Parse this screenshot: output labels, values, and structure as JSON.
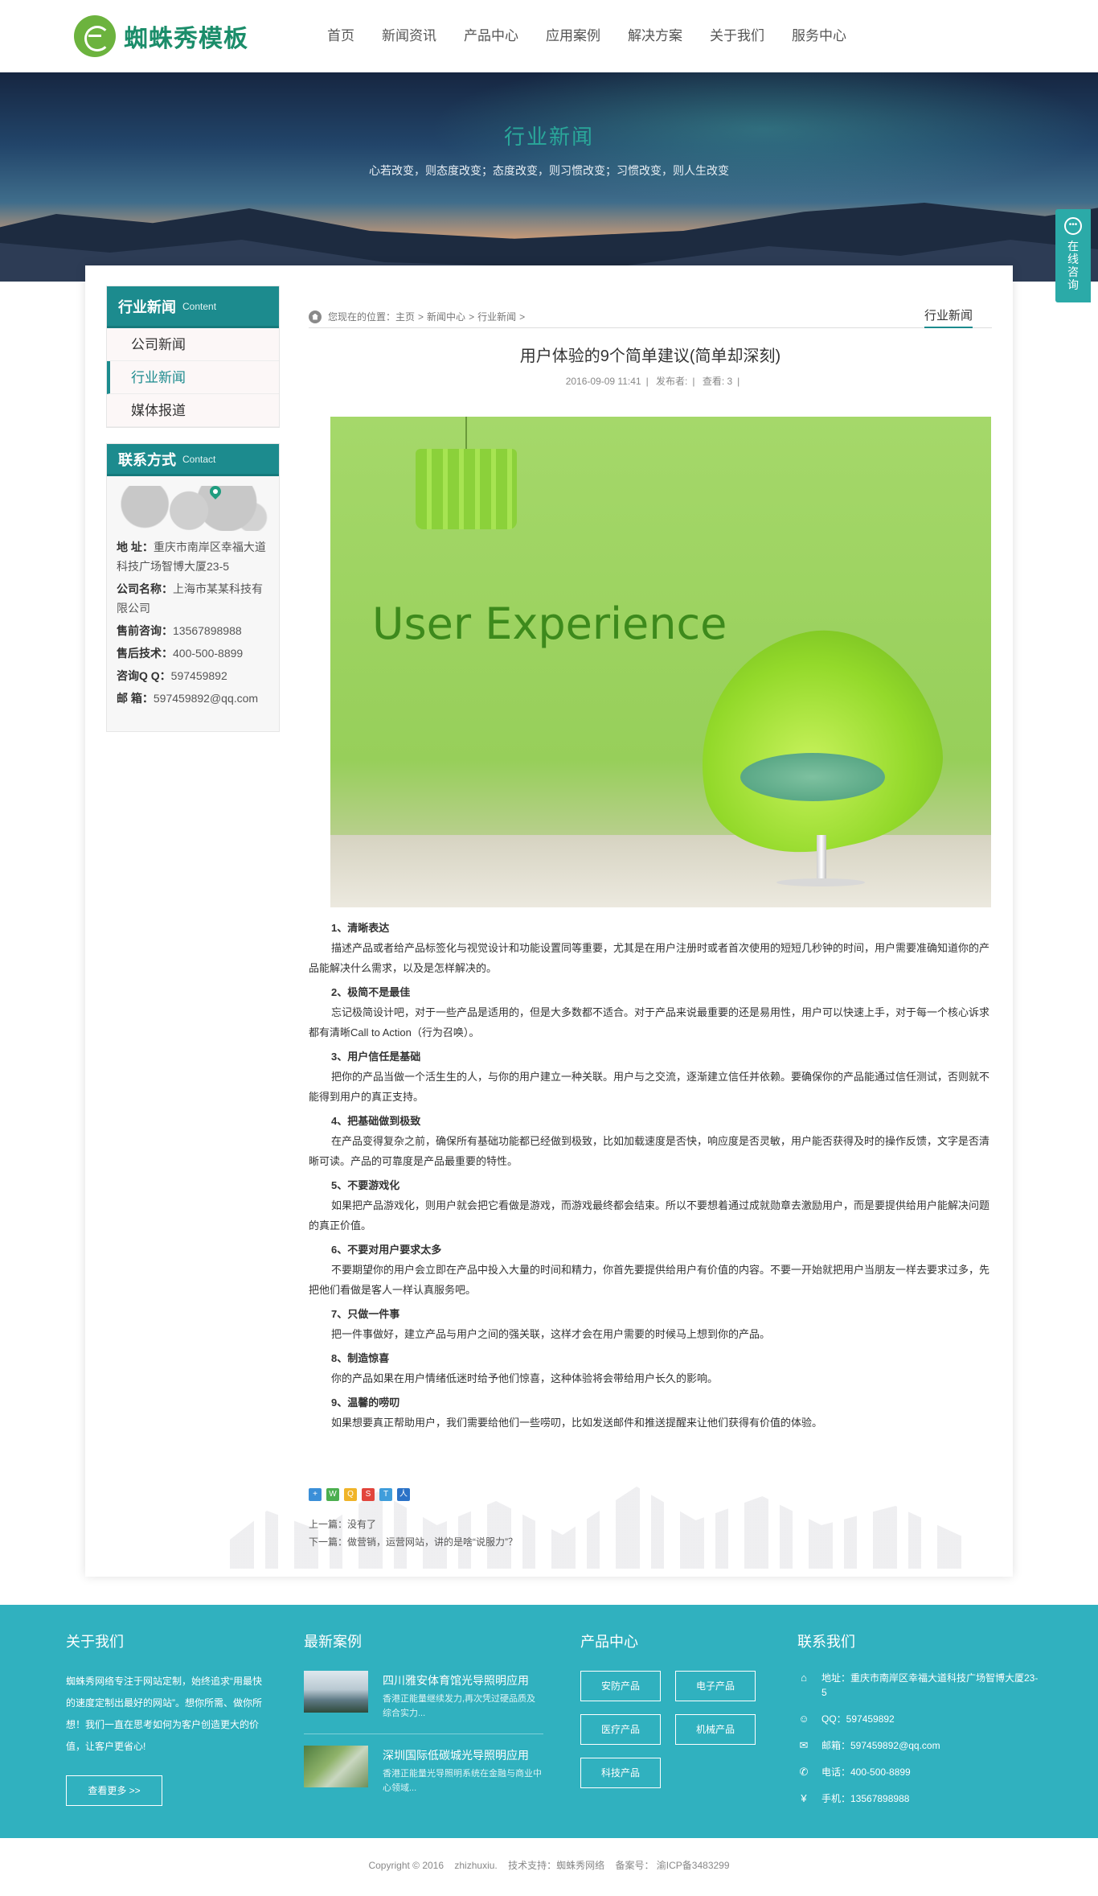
{
  "header": {
    "logo_text": "蜘蛛秀模板",
    "nav": [
      "首页",
      "新闻资讯",
      "产品中心",
      "应用案例",
      "解决方案",
      "关于我们",
      "服务中心"
    ]
  },
  "banner": {
    "title": "行业新闻",
    "subtitle": "心若改变，则态度改变；态度改变，则习惯改变；习惯改变，则人生改变"
  },
  "float_tab": {
    "text": "在线咨询"
  },
  "sidebar": {
    "news_head_cn": "行业新闻",
    "news_head_en": "Content",
    "items": [
      "公司新闻",
      "行业新闻",
      "媒体报道"
    ],
    "active_index": 1,
    "contact_head_cn": "联系方式",
    "contact_head_en": "Contact",
    "contact": [
      {
        "label": "地 址：",
        "value": "重庆市南岸区幸福大道科技广场智博大厦23-5"
      },
      {
        "label": "公司名称：",
        "value": "上海市某某科技有限公司"
      },
      {
        "label": "售前咨询：",
        "value": "13567898988"
      },
      {
        "label": "售后技术：",
        "value": "400-500-8899"
      },
      {
        "label": "咨询Q Q：",
        "value": "597459892"
      },
      {
        "label": "邮 箱：",
        "value": "597459892@qq.com"
      }
    ]
  },
  "breadcrumb": {
    "prefix": "您现在的位置：",
    "items": [
      "主页",
      "新闻中心",
      "行业新闻"
    ],
    "current_tab": "行业新闻"
  },
  "article": {
    "title": "用户体验的9个简单建议(简单却深刻)",
    "date": "2016-09-09 11:41",
    "author_label": "发布者:",
    "views_label": "查看: 3",
    "image_text": "User Experience",
    "sections": [
      {
        "h": "1、清晰表达",
        "p": "描述产品或者给产品标签化与视觉设计和功能设置同等重要，尤其是在用户注册时或者首次使用的短短几秒钟的时间，用户需要准确知道你的产品能解决什么需求，以及是怎样解决的。"
      },
      {
        "h": "2、极简不是最佳",
        "p": "忘记极简设计吧，对于一些产品是适用的，但是大多数都不适合。对于产品来说最重要的还是易用性，用户可以快速上手，对于每一个核心诉求都有清晰Call to Action（行为召唤）。"
      },
      {
        "h": "3、用户信任是基础",
        "p": "把你的产品当做一个活生生的人，与你的用户建立一种关联。用户与之交流，逐渐建立信任并依赖。要确保你的产品能通过信任测试，否则就不能得到用户的真正支持。"
      },
      {
        "h": "4、把基础做到极致",
        "p": "在产品变得复杂之前，确保所有基础功能都已经做到极致，比如加载速度是否快，响应度是否灵敏，用户能否获得及时的操作反馈，文字是否清晰可读。产品的可靠度是产品最重要的特性。"
      },
      {
        "h": "5、不要游戏化",
        "p": "如果把产品游戏化，则用户就会把它看做是游戏，而游戏最终都会结束。所以不要想着通过成就勋章去激励用户，而是要提供给用户能解决问题的真正价值。"
      },
      {
        "h": "6、不要对用户要求太多",
        "p": "不要期望你的用户会立即在产品中投入大量的时间和精力，你首先要提供给用户有价值的内容。不要一开始就把用户当朋友一样去要求过多，先把他们看做是客人一样认真服务吧。"
      },
      {
        "h": "7、只做一件事",
        "p": "把一件事做好，建立产品与用户之间的强关联，这样才会在用户需要的时候马上想到你的产品。"
      },
      {
        "h": "8、制造惊喜",
        "p": "你的产品如果在用户情绪低迷时给予他们惊喜，这种体验将会带给用户长久的影响。"
      },
      {
        "h": "9、温馨的唠叨",
        "p": "如果想要真正帮助用户，我们需要给他们一些唠叨，比如发送邮件和推送提醒来让他们获得有价值的体验。"
      }
    ],
    "prev": "上一篇：没有了",
    "next": "下一篇：做营销，运营网站，讲的是啥“说服力”？"
  },
  "footer": {
    "about_title": "关于我们",
    "about_text": "蜘蛛秀网络专注于网站定制，始终追求“用最快的速度定制出最好的网站”。想你所需、做你所想！我们一直在思考如何为客户创造更大的价值，让客户更省心!",
    "more_label": "查看更多 >>",
    "cases_title": "最新案例",
    "cases": [
      {
        "title": "四川雅安体育馆光导照明应用",
        "desc": "香港正能量继续发力,再次凭过硬品质及综合实力..."
      },
      {
        "title": "深圳国际低碳城光导照明应用",
        "desc": "香港正能量光导照明系统在金融与商业中心领域..."
      }
    ],
    "products_title": "产品中心",
    "products": [
      "安防产品",
      "电子产品",
      "医疗产品",
      "机械产品",
      "科技产品"
    ],
    "contact_title": "联系我们",
    "contact": [
      {
        "icon": "location-icon",
        "text": "地址：重庆市南岸区幸福大道科技广场智博大厦23-5"
      },
      {
        "icon": "qq-icon",
        "text": "QQ：597459892"
      },
      {
        "icon": "mail-icon",
        "text": "邮箱：597459892@qq.com"
      },
      {
        "icon": "phone-icon",
        "text": "电话：400-500-8899"
      },
      {
        "icon": "yen-icon",
        "text": "手机：13567898988"
      }
    ]
  },
  "copyright": {
    "copy": "Copyright © 2016",
    "site": "zhizhuxiu.",
    "support": "技术支持：蜘蛛秀网络",
    "icp": "备案号： 渝ICP备3483299"
  },
  "colors": {
    "brand": "#1c8b8e",
    "footer": "#30b1bf",
    "logo_green": "#6cb33e"
  }
}
